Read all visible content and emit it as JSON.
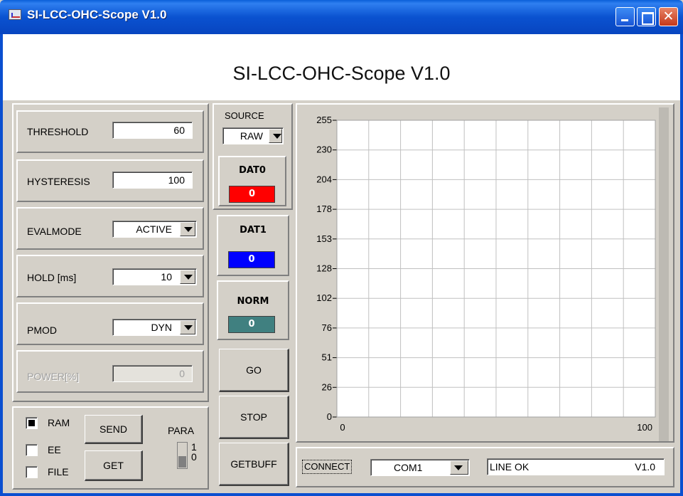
{
  "window": {
    "title": "SI-LCC-OHC-Scope V1.0"
  },
  "header": {
    "title": "SI-LCC-OHC-Scope V1.0"
  },
  "params": {
    "threshold_label": "THRESHOLD",
    "threshold_value": "60",
    "hysteresis_label": "HYSTERESIS",
    "hysteresis_value": "100",
    "evalmode_label": "EVALMODE",
    "evalmode_value": "ACTIVE",
    "hold_label": "HOLD [ms]",
    "hold_value": "10",
    "pmod_label": "PMOD",
    "pmod_value": "DYN",
    "power_label": "POWER[%]",
    "power_value": "0"
  },
  "storage": {
    "ram_label": "RAM",
    "ram_checked": true,
    "ee_label": "EE",
    "ee_checked": false,
    "file_label": "FILE",
    "file_checked": false,
    "send_label": "SEND",
    "get_label": "GET",
    "para_label": "PARA",
    "para_1": "1",
    "para_0": "0"
  },
  "source": {
    "label": "SOURCE",
    "value": "RAW"
  },
  "data": {
    "dat0_label": "DAT0",
    "dat0_value": "0",
    "dat0_color": "#ff0000",
    "dat1_label": "DAT1",
    "dat1_value": "0",
    "dat1_color": "#0000ff",
    "norm_label": "NORM",
    "norm_value": "0",
    "norm_color": "#408080"
  },
  "buttons": {
    "go": "GO",
    "stop": "STOP",
    "getbuff": "GETBUFF"
  },
  "chart_data": {
    "type": "line",
    "yticks": [
      "255",
      "230",
      "204",
      "178",
      "153",
      "128",
      "102",
      "76",
      "51",
      "26",
      "0"
    ],
    "xticks": [
      "0",
      "100"
    ],
    "xlim": [
      0,
      100
    ],
    "ylim": [
      0,
      255
    ],
    "grid": true,
    "series": []
  },
  "status": {
    "connect_label": "CONNECT",
    "port": "COM1",
    "line_status": "LINE OK",
    "version": "V1.0"
  }
}
